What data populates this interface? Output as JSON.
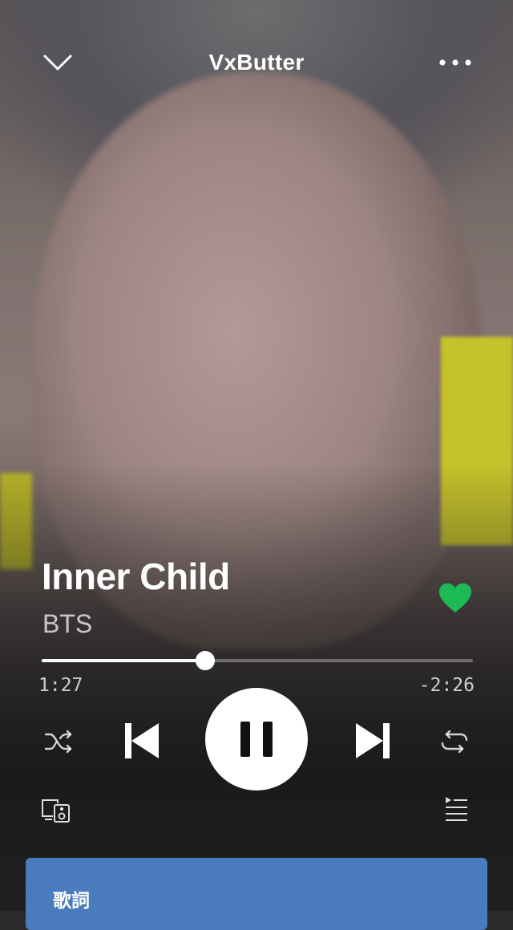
{
  "header": {
    "title": "VxButter",
    "collapse_icon": "chevron-down-icon",
    "more_icon": "more-dots-icon"
  },
  "track": {
    "title": "Inner Child",
    "artist": "BTS",
    "liked": true
  },
  "playback": {
    "elapsed": "1:27",
    "remaining": "-2:26",
    "progress": 0.38,
    "state": "playing"
  },
  "controls": {
    "shuffle_icon": "shuffle-icon",
    "previous_icon": "skip-previous-icon",
    "pause_icon": "pause-icon",
    "next_icon": "skip-next-icon",
    "repeat_icon": "repeat-icon",
    "devices_icon": "devices-icon",
    "queue_icon": "queue-icon"
  },
  "lyrics": {
    "label": "歌詞"
  },
  "colors": {
    "like_green": "#1DB954",
    "lyrics_card": "#4A7BBD"
  }
}
